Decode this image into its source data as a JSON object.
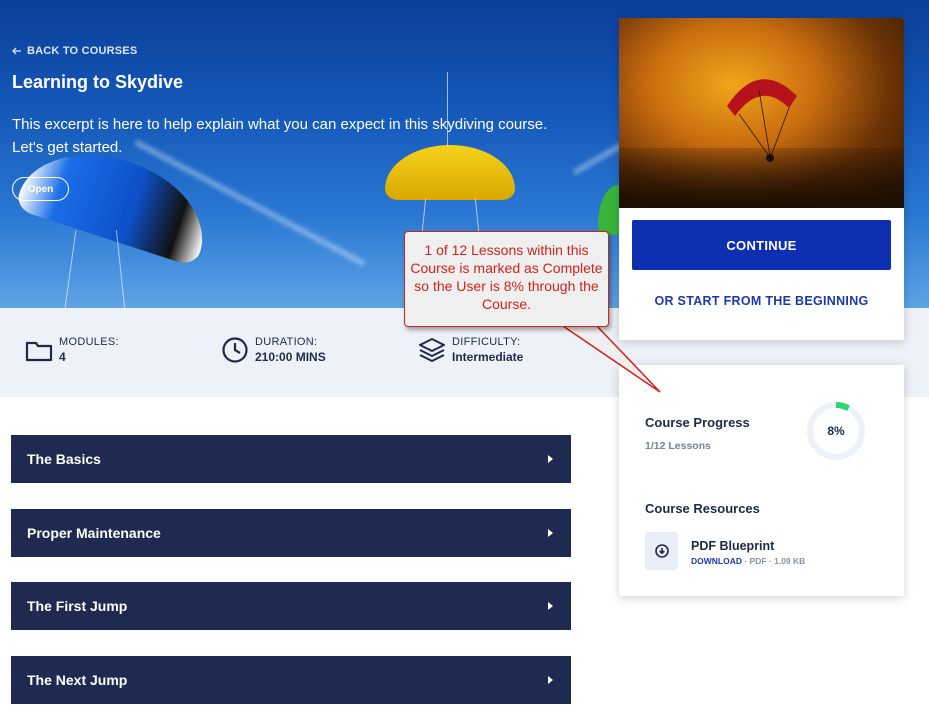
{
  "hero": {
    "back_label": "BACK TO COURSES",
    "title": "Learning to Skydive",
    "excerpt": "This excerpt is here to help explain what you can expect in this skydiving course. Let's get started.",
    "status_pill": "Open"
  },
  "stats": {
    "modules": {
      "label": "MODULES:",
      "value": "4",
      "icon": "folder-icon"
    },
    "duration": {
      "label": "DURATION:",
      "value": "210:00 MINS",
      "icon": "clock-icon"
    },
    "difficulty": {
      "label": "DIFFICULTY:",
      "value": "Intermediate",
      "icon": "layers-icon"
    }
  },
  "modules": [
    {
      "title": "The Basics"
    },
    {
      "title": "Proper Maintenance"
    },
    {
      "title": "The First Jump"
    },
    {
      "title": "The Next Jump"
    }
  ],
  "cta": {
    "continue_label": "CONTINUE",
    "start_label": "OR START FROM THE BEGINNING"
  },
  "progress": {
    "title": "Course Progress",
    "lessons": "1/12 Lessons",
    "percent_label": "8%",
    "percent_value": 8
  },
  "resources": {
    "title": "Course Resources",
    "items": [
      {
        "name": "PDF Blueprint",
        "download_label": "DOWNLOAD",
        "meta": " · PDF · 1.09 KB",
        "icon": "download-icon"
      }
    ]
  },
  "callout": {
    "text": "1 of 12 Lessons within this Course is marked as Complete so the User is 8% through the Course."
  },
  "colors": {
    "navy": "#1e2a4f",
    "primary_blue": "#0f2fb3",
    "progress_green": "#2ed573",
    "callout_red": "#d0231a"
  }
}
